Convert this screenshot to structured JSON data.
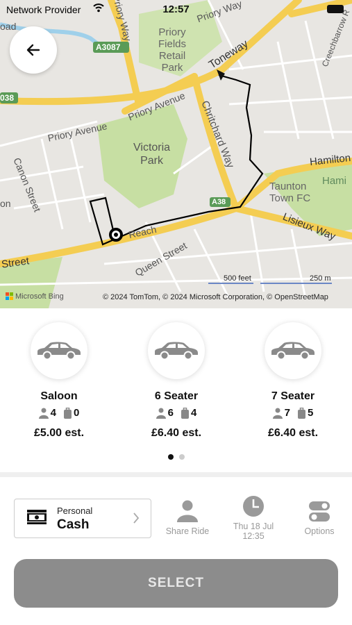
{
  "status_bar": {
    "carrier": "Network Provider",
    "time": "12:57"
  },
  "map": {
    "labels": {
      "priory_fields": "Priory Fields Retail Park",
      "priory_fields_lines": [
        "Priory",
        "Fields",
        "Retail",
        "Park"
      ],
      "toneway": "Toneway",
      "priory_avenue_1": "Priory Avenue",
      "priory_avenue_2": "Priory Avenue",
      "victoria_park": "Victoria Park",
      "victoria_lines": [
        "Victoria",
        "Park"
      ],
      "chritchard_way": "Chritchard Way",
      "hamilton": "Hamilton",
      "hami": "Hami",
      "taunton_lines": [
        "Taunton",
        "Town FC"
      ],
      "lisieux_way": "Lisieux Way",
      "canon_street": "Canon Street",
      "queen_street": "Queen Street",
      "reach": "Reach",
      "street": "Street",
      "road_a3087": "A3087",
      "road_a38": "A38",
      "road_038": "038",
      "priory_way": "Priory Way",
      "creechbarrow": "Creechbarrow R",
      "oad": "oad",
      "on": "on",
      "ha": "ha"
    },
    "scale": {
      "feet": "500 feet",
      "meters": "250 m"
    },
    "attribution": {
      "bing": "Microsoft Bing",
      "copyright": "© 2024 TomTom, © 2024 Microsoft Corporation, © OpenStreetMap"
    }
  },
  "vehicles": [
    {
      "name": "Saloon",
      "passengers": "4",
      "luggage": "0",
      "price": "£5.00 est."
    },
    {
      "name": "6 Seater",
      "passengers": "6",
      "luggage": "4",
      "price": "£6.40 est."
    },
    {
      "name": "7 Seater",
      "passengers": "7",
      "luggage": "5",
      "price": "£6.40 est."
    }
  ],
  "pagination": {
    "pages": 2,
    "active": 1
  },
  "payment": {
    "label": "Personal",
    "value": "Cash"
  },
  "options": {
    "share_ride": "Share Ride",
    "date": "Thu 18 Jul",
    "time": "12:35",
    "options": "Options"
  },
  "select_button": "SELECT",
  "colors": {
    "button": "#8c8c8c",
    "major_road": "#f4cd52",
    "park": "#c7dfa3",
    "route": "#000000"
  }
}
